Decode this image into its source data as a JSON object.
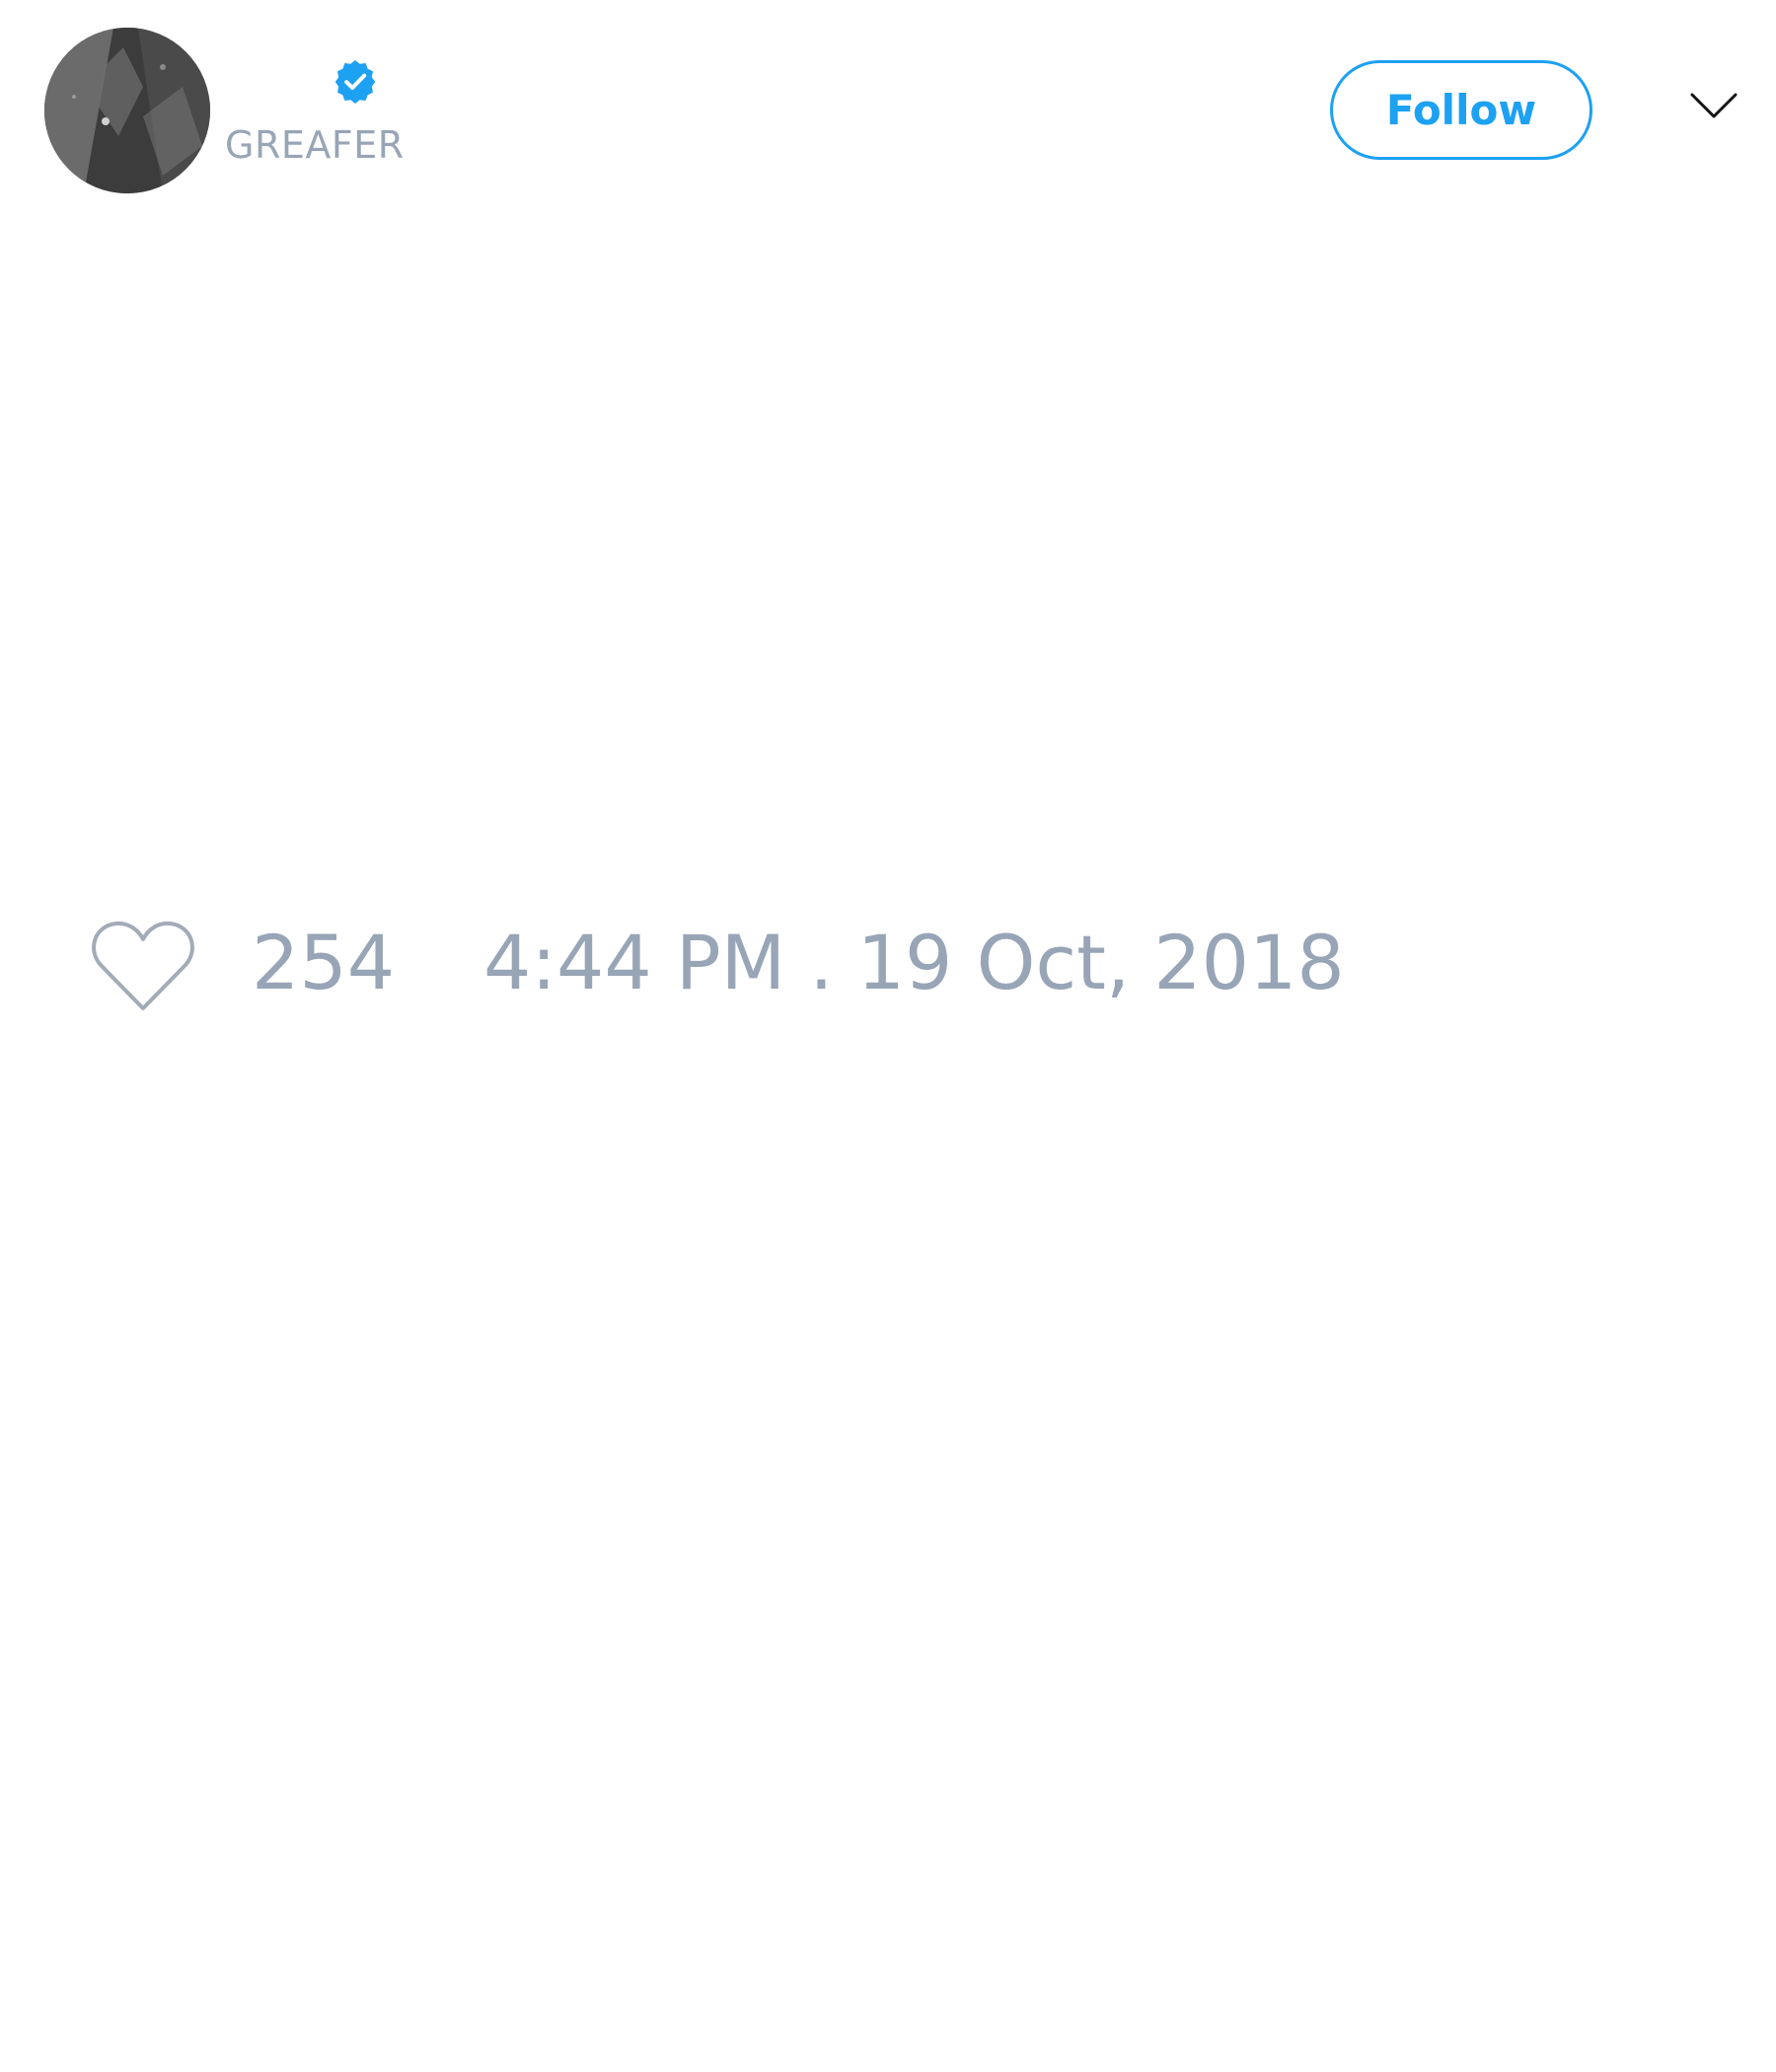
{
  "tweet": {
    "author": {
      "handle": "GREAFER",
      "verified": true
    },
    "follow_label": "Follow",
    "likes": "254",
    "timestamp": "4:44 PM . 19 Oct, 2018"
  },
  "icons": {
    "verified": "verified-badge-icon",
    "menu": "chevron-down-icon",
    "like": "heart-icon"
  },
  "colors": {
    "accent": "#1da1f2",
    "muted_text": "#98a5b6",
    "heart_outline": "#a2abb8",
    "background": "#ffffff"
  }
}
